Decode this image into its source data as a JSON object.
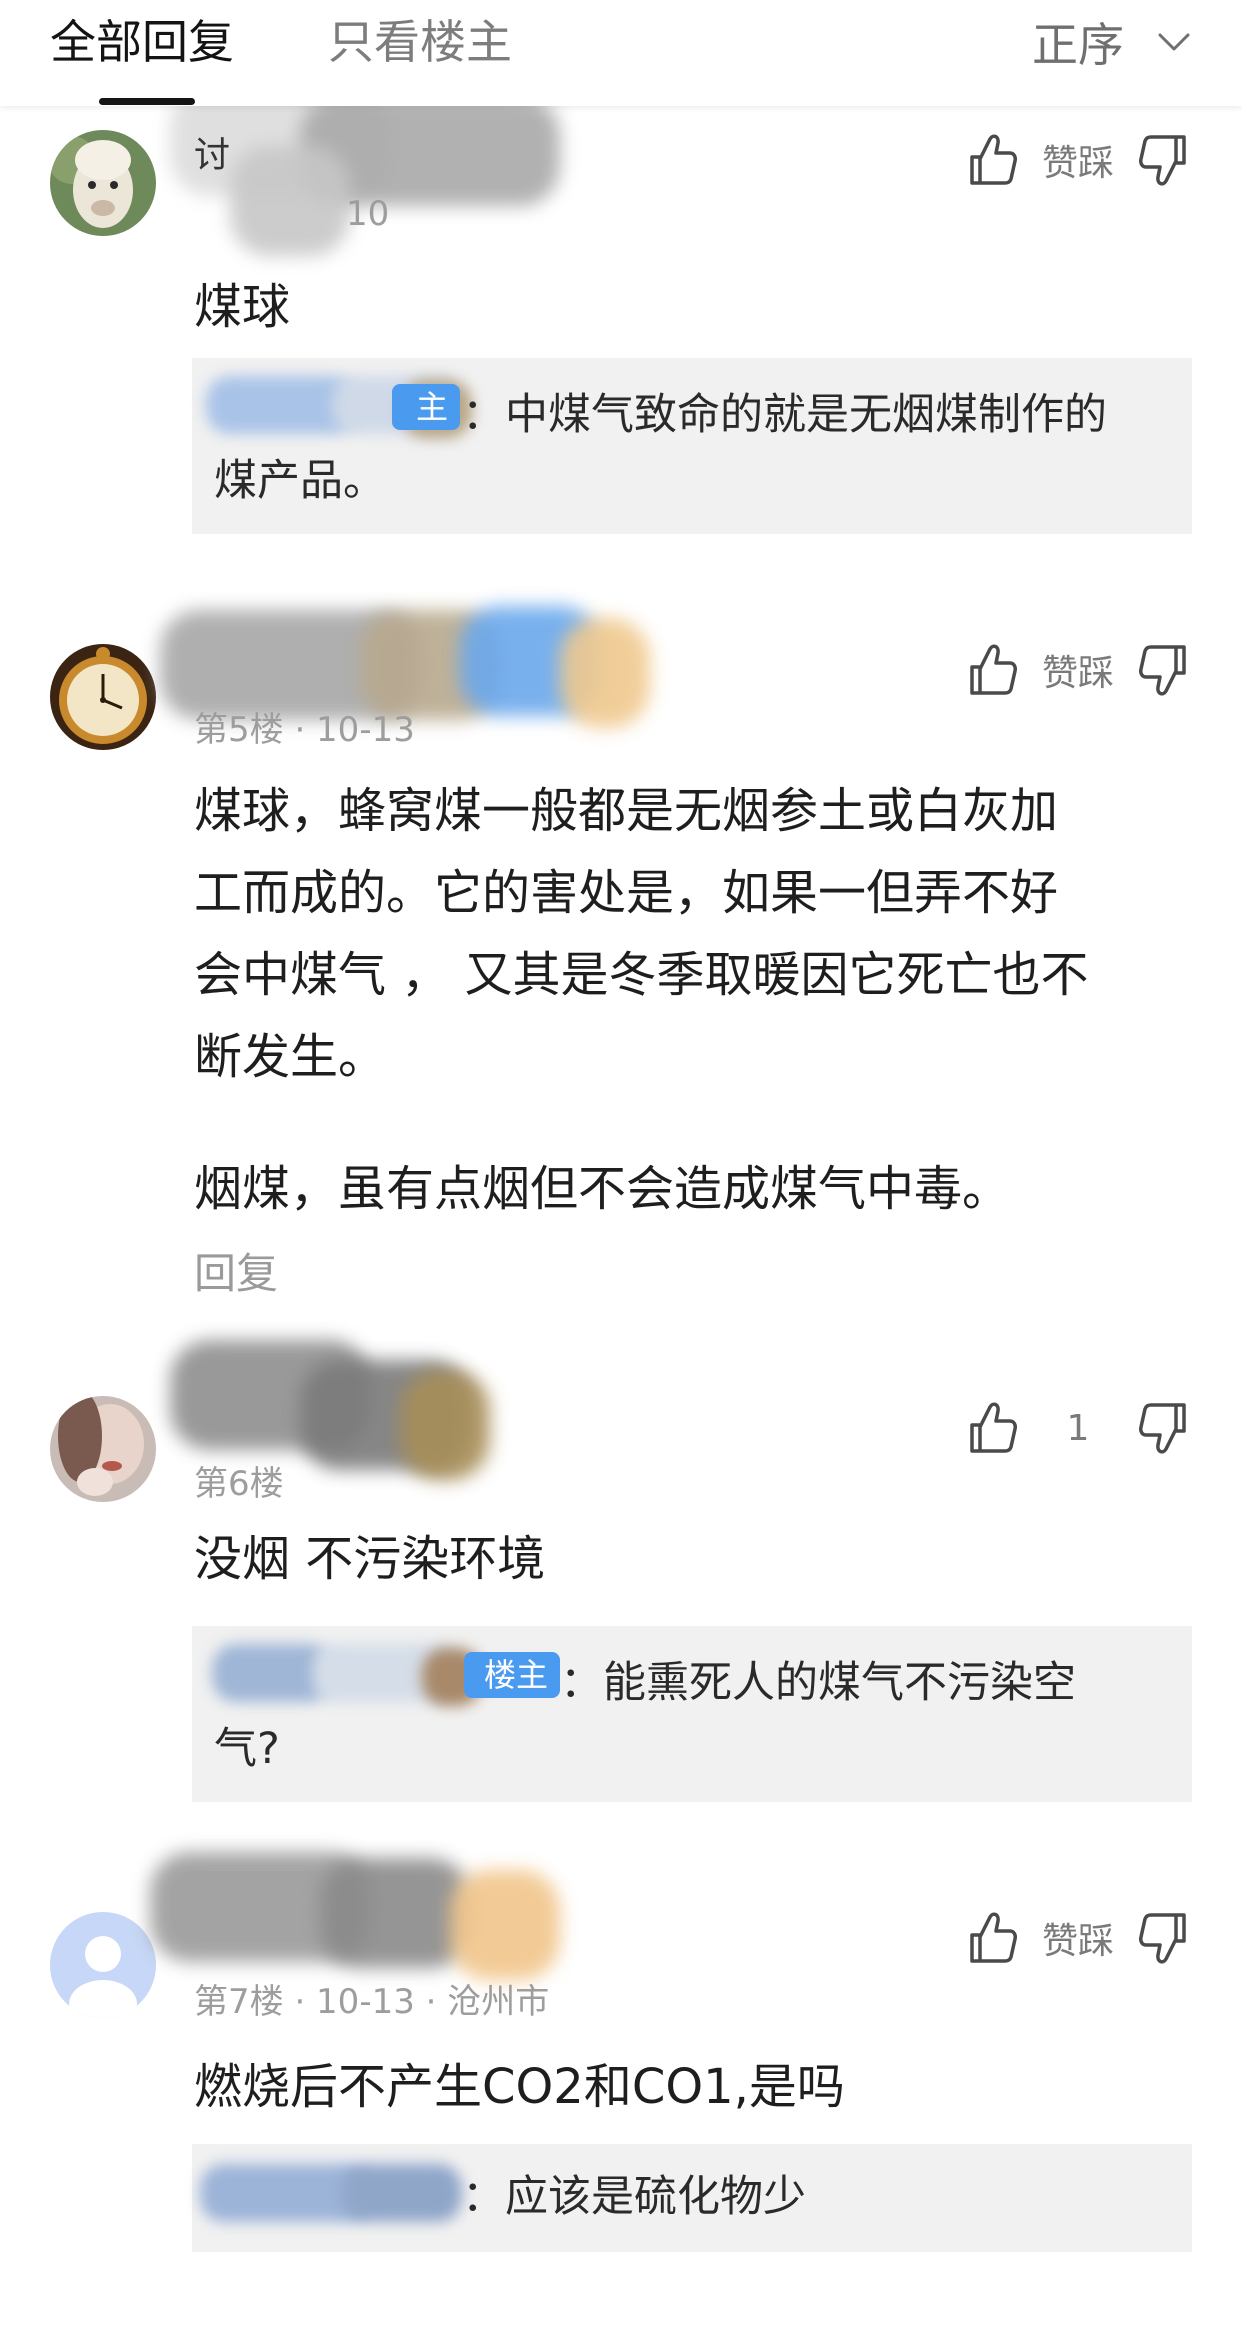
{
  "tabs": {
    "all": "全部回复",
    "owner_only": "只看楼主",
    "sort": "正序"
  },
  "icons": {
    "sort": "chevron-down-icon",
    "like": "thumbs-up-icon",
    "dislike": "thumbs-down-icon"
  },
  "colors": {
    "owner_badge": "#4a9af0",
    "quote_bg": "#f1f1f1",
    "meta_text": "#9d9d9d"
  },
  "posts": [
    {
      "name_visible": "讨",
      "meta": "10",
      "action_label": "赞踩",
      "body": "煤球",
      "quote": {
        "badge": "主",
        "text": "：中煤气致命的就是无烟煤制作的煤产品。"
      }
    },
    {
      "meta": "第5楼 · 10-13",
      "action_label": "赞踩",
      "body_lines": [
        "煤球，蜂窝煤一般都是无烟参土或白灰加",
        "工而成的。它的害处是，如果一但弄不好",
        "会中煤气 ， 又其是冬季取暖因它死亡也不",
        "断发生。"
      ],
      "body_extra": "烟煤，虽有点烟但不会造成煤气中毒。",
      "reply": "回复"
    },
    {
      "meta": "第6楼",
      "action_label": "1",
      "body": "没烟 不污染环境",
      "quote": {
        "badge": "楼主",
        "text": "：能熏死人的煤气不污染空气?"
      }
    },
    {
      "meta": "第7楼 · 10-13 · 沧州市",
      "action_label": "赞踩",
      "body": "燃烧后不产生CO2和CO1,是吗",
      "quote": {
        "text": "：应该是硫化物少"
      }
    }
  ]
}
